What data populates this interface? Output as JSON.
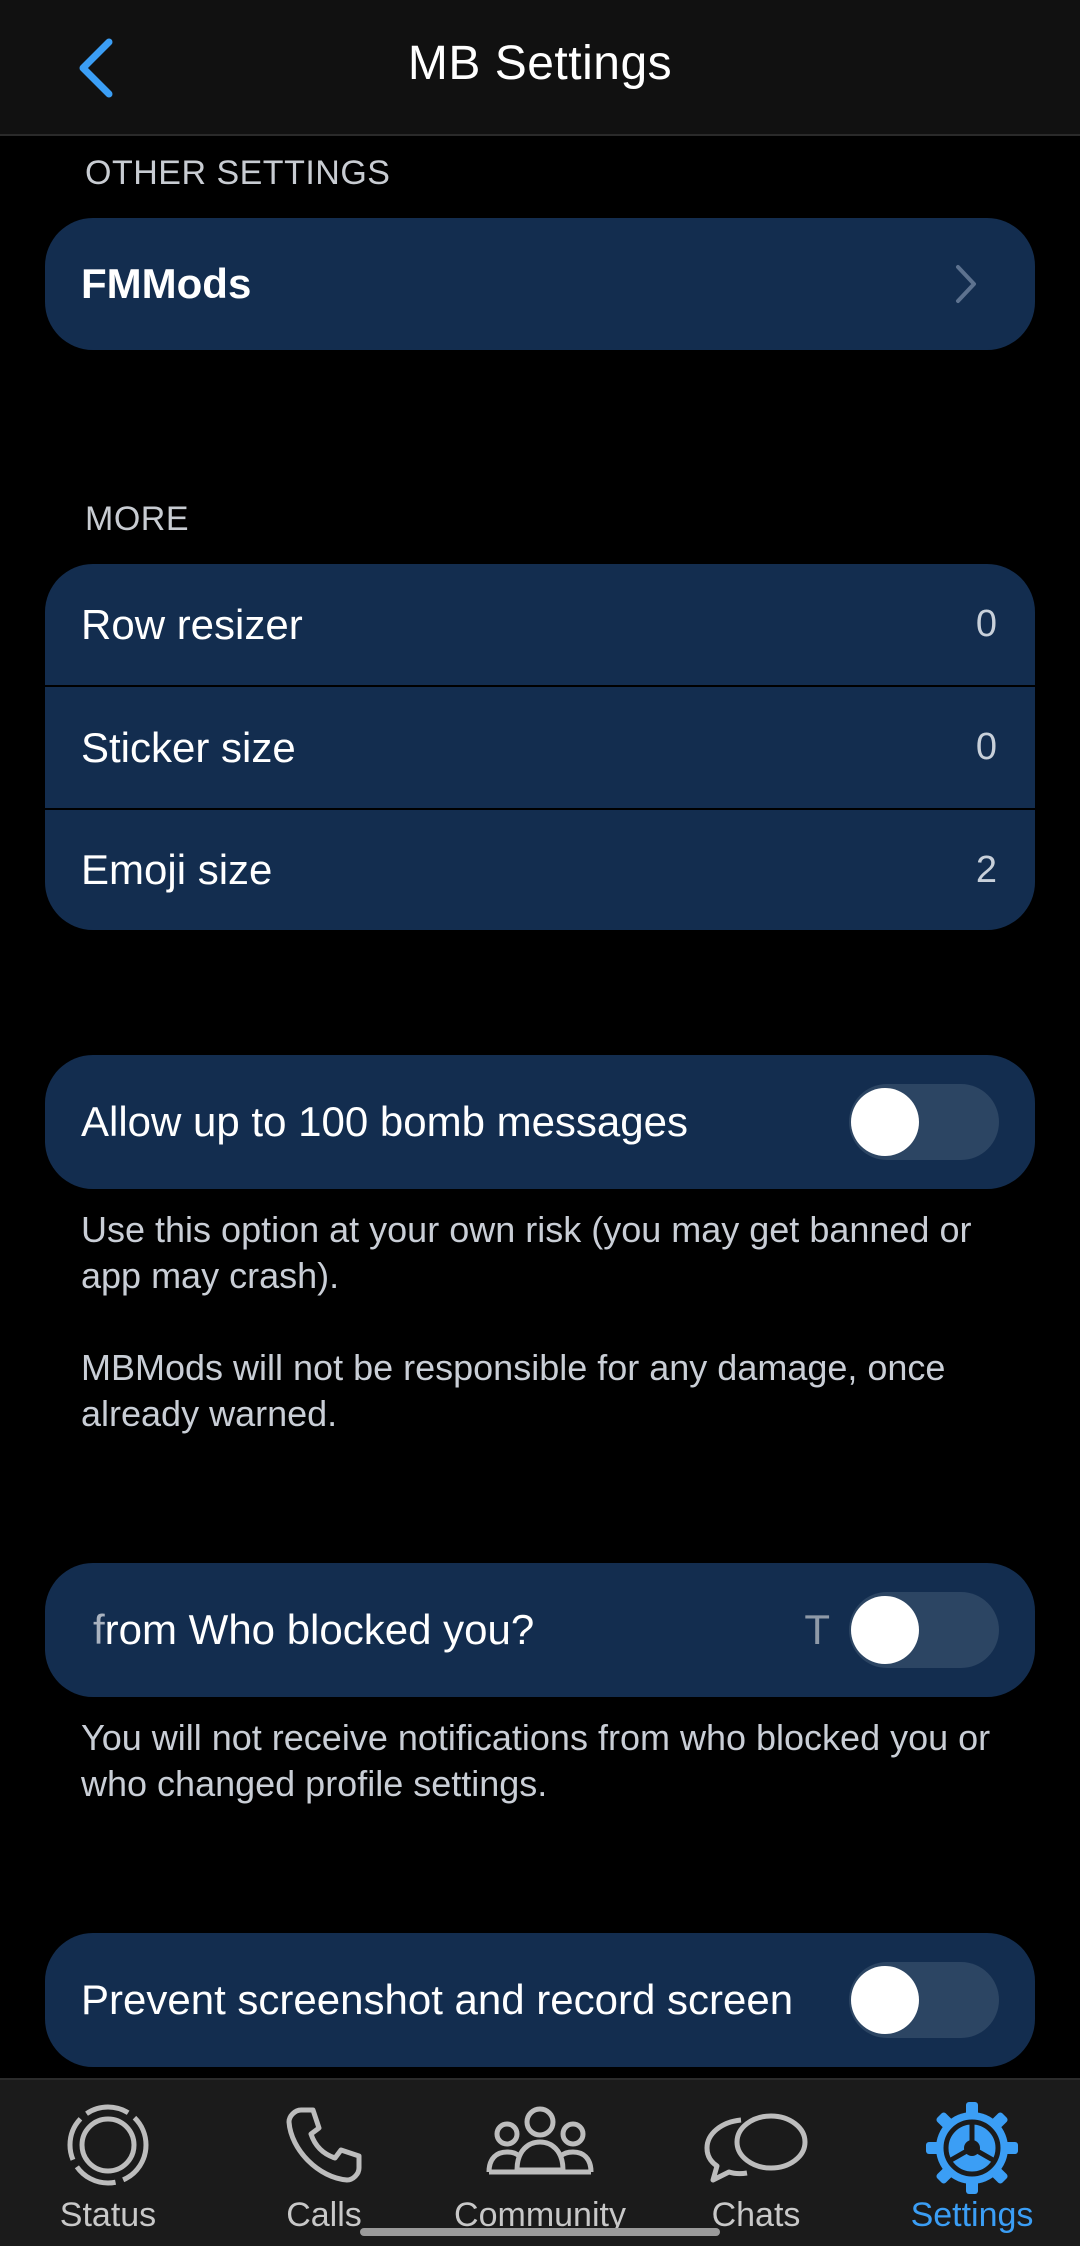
{
  "header": {
    "title": "MB Settings"
  },
  "sections": {
    "other_settings": {
      "label": "OTHER SETTINGS",
      "fmmods_label": "FMMods"
    },
    "more": {
      "label": "MORE",
      "rows": [
        {
          "label": "Row resizer",
          "value": "0"
        },
        {
          "label": "Sticker size",
          "value": "0"
        },
        {
          "label": "Emoji size",
          "value": "2"
        }
      ]
    }
  },
  "toggles": {
    "bomb": {
      "label": "Allow up to 100 bomb messages",
      "on": false,
      "desc1": "Use this option at your own risk (you may get banned or app may crash).",
      "desc2": "MBMods will not be responsible for any damage, once already warned."
    },
    "blocked": {
      "label_prefix": "f",
      "label": "rom Who blocked you?",
      "trailing_text": "T",
      "on": false,
      "desc": "You will not receive notifications from who blocked you or who changed profile settings."
    },
    "screenshot": {
      "label": "Prevent screenshot and record screen",
      "on": false
    }
  },
  "bottom_nav": {
    "items": [
      {
        "label": "Status",
        "icon": "status-icon"
      },
      {
        "label": "Calls",
        "icon": "phone-icon"
      },
      {
        "label": "Community",
        "icon": "community-icon"
      },
      {
        "label": "Chats",
        "icon": "chat-bubbles-icon"
      },
      {
        "label": "Settings",
        "icon": "gear-icon",
        "active": true
      }
    ]
  },
  "colors": {
    "accent": "#3b9ef5",
    "card": "#132d4f",
    "background": "#000000"
  }
}
